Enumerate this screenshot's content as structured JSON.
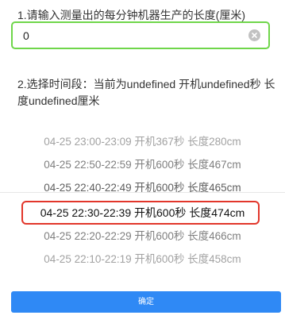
{
  "step1": {
    "label": "1.请输入测量出的每分钟机器生产的长度(厘米)",
    "input_value": "0"
  },
  "step2": {
    "label": "2.选择时间段：当前为undefined 开机undefined秒 长度undefined厘米"
  },
  "picker": {
    "options": [
      {
        "text": "04-25 23:00-23:09 开机367秒 长度280cm",
        "opacity": 0.35
      },
      {
        "text": "04-25 22:50-22:59 开机600秒 长度467cm",
        "opacity": 0.55
      },
      {
        "text": "04-25 22:40-22:49 开机600秒 长度465cm",
        "opacity": 0.75
      },
      {
        "text": "04-25 22:30-22:39 开机600秒 长度474cm",
        "opacity": 1.0
      },
      {
        "text": "04-25 22:20-22:29 开机600秒 长度466cm",
        "opacity": 0.55
      },
      {
        "text": "04-25 22:10-22:19 开机600秒 长度458cm",
        "opacity": 0.35
      }
    ],
    "selected_index": 3
  },
  "confirm": {
    "label": "确定"
  },
  "colors": {
    "input_border": "#6fd64a",
    "highlight_border": "#e2362b",
    "button_bg": "#2f89f5"
  }
}
